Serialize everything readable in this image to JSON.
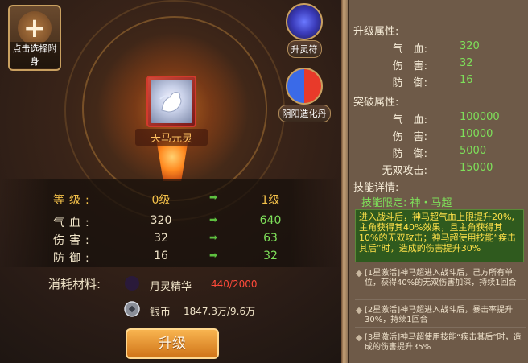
{
  "slot": {
    "label": "点击选择附身"
  },
  "card": {
    "name": "天马元灵"
  },
  "skill_buttons": [
    {
      "label": "升灵符",
      "icon": "blue-swirl-icon"
    },
    {
      "label": "阴阳造化丹",
      "icon": "yin-yang-icon"
    }
  ],
  "stats": {
    "level": {
      "label": "等级:",
      "current": "0级",
      "next": "1级"
    },
    "rows": [
      {
        "label": "气血:",
        "current": "320",
        "next": "640"
      },
      {
        "label": "伤害:",
        "current": "32",
        "next": "63"
      },
      {
        "label": "防御:",
        "current": "16",
        "next": "32"
      }
    ]
  },
  "materials": {
    "label": "消耗材料:",
    "moon": {
      "name": "月灵精华",
      "count": "440/2000",
      "icon": "crescent-moon-icon"
    },
    "coin": {
      "name": "银币",
      "value": "1847.3万/9.6万",
      "icon": "silver-coin-icon"
    }
  },
  "upgrade_button": "升级",
  "right": {
    "upgrade_title": "升级属性:",
    "upgrade_attrs": [
      {
        "k": "气　血:",
        "v": "320"
      },
      {
        "k": "伤　害:",
        "v": "32"
      },
      {
        "k": "防　御:",
        "v": "16"
      }
    ],
    "breakthrough_title": "突破属性:",
    "breakthrough_attrs": [
      {
        "k": "气　血:",
        "v": "100000"
      },
      {
        "k": "伤　害:",
        "v": "10000"
      },
      {
        "k": "防　御:",
        "v": "5000"
      },
      {
        "k": "无双攻击:",
        "v": "15000"
      }
    ],
    "skill_title": "技能详情:",
    "skill_limit": "技能限定: 神・马超",
    "skill_desc": "进入战斗后，神马超气血上限提升20%,主角获得其40%效果，且主角获得其10%的无双攻击；神马超使用技能“疾击其后”时，造成的伤害提升30%",
    "stars": [
      "[1星激活]神马超进入战斗后，己方所有单位，获得40%的无双伤害加深，持续1回合",
      "[2星激活]神马超进入战斗后，暴击率提升30%，持续1回合",
      "[3星激活]神马超使用技能“疾击其后”时，造成的伤害提升35%"
    ]
  },
  "colors": {
    "accent_gold": "#f5c24a",
    "green": "#7ee05a",
    "red": "#ff4a3a"
  }
}
